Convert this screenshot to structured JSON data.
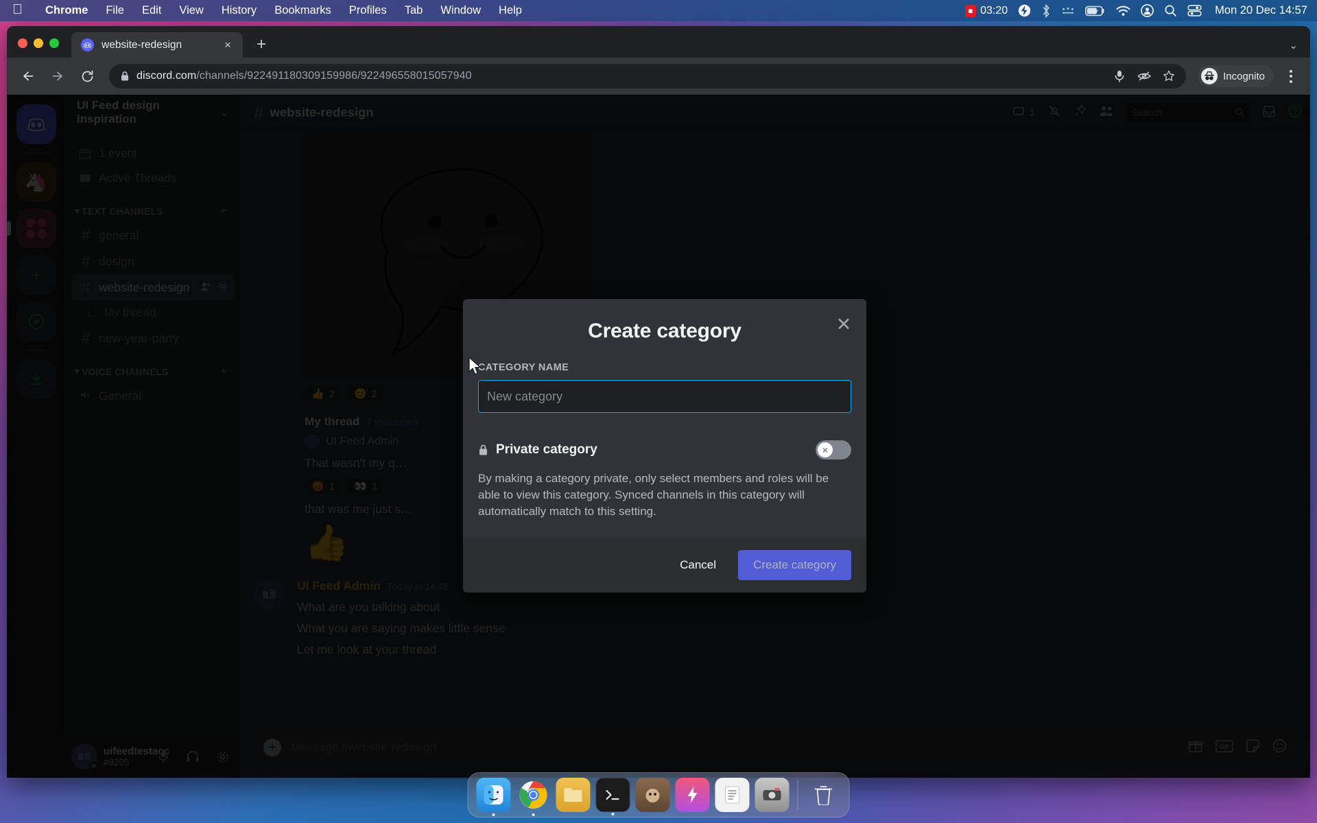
{
  "menubar": {
    "apple_icon": "apple-logo",
    "items": [
      "Chrome",
      "File",
      "Edit",
      "View",
      "History",
      "Bookmarks",
      "Profiles",
      "Tab",
      "Window",
      "Help"
    ],
    "recording_time": "03:20",
    "clock": "Mon 20 Dec  14:57",
    "status_icons": [
      "screen-record-icon",
      "bolt-icon",
      "bluetooth-icon",
      "dots-icon",
      "battery-charging-icon",
      "wifi-icon",
      "control-center-user-icon",
      "search-icon",
      "control-center-icon"
    ]
  },
  "browser": {
    "tab": {
      "title": "website-redesign",
      "favicon": "discord-icon",
      "close": "×"
    },
    "new_tab": "+",
    "tabstrip_chevron": "⌄",
    "url": {
      "host": "discord.com",
      "path": "/channels/922491180309159986/922496558015057940"
    },
    "toolbar_icons": [
      "back-icon",
      "forward-icon",
      "reload-icon",
      "lock-icon",
      "microphone-icon",
      "eye-off-icon",
      "bookmark-star-icon"
    ],
    "incognito_label": "Incognito"
  },
  "discord": {
    "server_name": "UI Feed design inspiration",
    "server_chevron": "⌄",
    "sidebar_top": [
      {
        "icon": "calendar-icon",
        "label": "1 event"
      },
      {
        "icon": "threads-icon",
        "label": "Active Threads"
      }
    ],
    "categories": [
      {
        "label": "TEXT CHANNELS",
        "add_label": "+",
        "channels": [
          {
            "name": "general",
            "active": false,
            "type": "text"
          },
          {
            "name": "design",
            "active": false,
            "type": "text"
          },
          {
            "name": "website-redesign",
            "active": true,
            "type": "text",
            "actions": [
              "add-member-icon",
              "settings-icon"
            ]
          },
          {
            "name": "My thread",
            "active": false,
            "type": "thread"
          },
          {
            "name": "new-year-party",
            "active": false,
            "type": "text"
          }
        ]
      },
      {
        "label": "VOICE CHANNELS",
        "add_label": "+",
        "channels": [
          {
            "name": "General",
            "active": false,
            "type": "voice"
          }
        ]
      }
    ],
    "user_panel": {
      "name": "uifeedtestacc",
      "tag": "#8205",
      "icons": [
        "microphone-icon",
        "headset-icon",
        "settings-gear-icon"
      ]
    },
    "channel_header": {
      "title": "website-redesign",
      "member_count": "1",
      "icons": [
        "threads-icon",
        "notification-off-icon",
        "pin-icon",
        "members-icon",
        "inbox-icon",
        "help-icon"
      ],
      "search_placeholder": "Search"
    },
    "messages": {
      "reactions_1": [
        {
          "emoji": "👍",
          "count": "2"
        },
        {
          "emoji": "😊",
          "count": "2"
        }
      ],
      "thread": {
        "name": "My thread",
        "meta": "7 messages",
        "author": "UI Feed Admin",
        "line1": "That wasn't my q…",
        "reactions": [
          {
            "emoji": "😡",
            "count": "1"
          },
          {
            "emoji": "👀",
            "count": "1"
          }
        ],
        "line2": "that was me just s…",
        "big_emoji": "👍"
      },
      "last_message": {
        "author": "UI Feed Admin",
        "time": "Today at 14:46",
        "lines": [
          "What are you talking about",
          "What you are saying makes little sense",
          "Let me look at your thread"
        ]
      },
      "composer_placeholder": "Message #website-redesign",
      "composer_icons": [
        "gift-icon",
        "gif-icon",
        "sticker-icon",
        "emoji-icon"
      ]
    }
  },
  "modal": {
    "title": "Create category",
    "close_icon": "close-icon",
    "field_label": "CATEGORY NAME",
    "input_value": "",
    "input_placeholder": "New category",
    "private_label": "Private category",
    "private_icon": "lock-icon",
    "private_toggle_state": "off",
    "private_toggle_glyph": "×",
    "description": "By making a category private, only select members and roles will be able to view this category. Synced channels in this category will automatically match to this setting.",
    "cancel_label": "Cancel",
    "create_label": "Create category",
    "accent_color": "#5865f2",
    "focus_border_color": "#00a8fc"
  },
  "dock": {
    "items": [
      {
        "name": "finder-icon",
        "glyph": "🖼",
        "running": true
      },
      {
        "name": "chrome-icon",
        "glyph": "◉",
        "running": true
      },
      {
        "name": "files-icon",
        "glyph": "🗂",
        "running": false
      },
      {
        "name": "terminal-icon",
        "glyph": "■",
        "running": true
      },
      {
        "name": "gimp-icon",
        "glyph": "🎨",
        "running": false
      },
      {
        "name": "shortcuts-icon",
        "glyph": "⚡",
        "running": false
      },
      {
        "name": "text-editor-icon",
        "glyph": "📄",
        "running": false
      },
      {
        "name": "screenshot-icon",
        "glyph": "📷",
        "running": false
      },
      {
        "name": "trash-icon",
        "glyph": "🗑",
        "running": false
      }
    ]
  }
}
